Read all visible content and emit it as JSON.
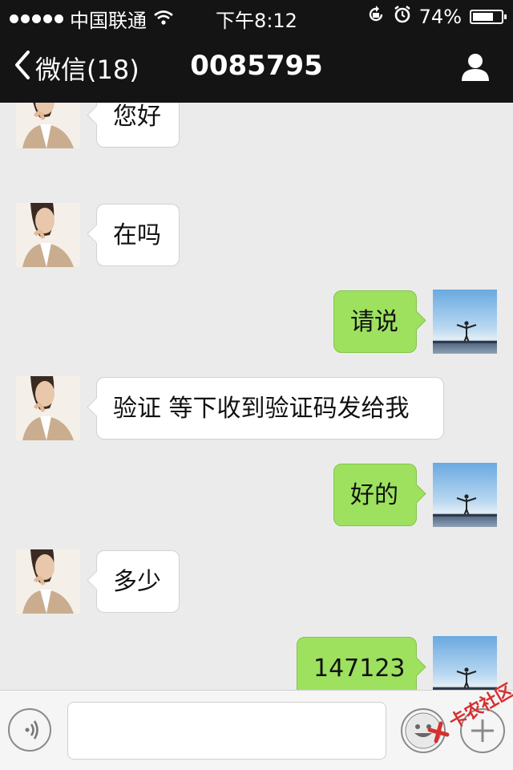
{
  "status_bar": {
    "carrier": "中国联通",
    "time": "下午8:12",
    "battery_percent": "74%",
    "battery_level": 0.74,
    "icons": [
      "signal-dots-icon",
      "wifi-icon",
      "orientation-lock-icon",
      "alarm-icon",
      "battery-icon"
    ]
  },
  "nav": {
    "back_label": "微信(18)",
    "title": "0085795",
    "back_icon": "chevron-left-icon",
    "profile_icon": "person-icon"
  },
  "messages": [
    {
      "direction": "in",
      "text": "您好",
      "avatar": "contact-avatar"
    },
    {
      "direction": "in",
      "text": "在吗",
      "avatar": "contact-avatar"
    },
    {
      "direction": "out",
      "text": "请说",
      "avatar": "my-avatar"
    },
    {
      "direction": "in",
      "text": "验证 等下收到验证码发给我",
      "avatar": "contact-avatar"
    },
    {
      "direction": "out",
      "text": "好的",
      "avatar": "my-avatar"
    },
    {
      "direction": "in",
      "text": "多少",
      "avatar": "contact-avatar"
    },
    {
      "direction": "out",
      "text": "147123",
      "avatar": "my-avatar"
    }
  ],
  "input_bar": {
    "value": "",
    "placeholder": "",
    "icons": [
      "voice-icon",
      "emoji-icon",
      "plus-icon"
    ]
  },
  "watermark": {
    "text": "卡农社区"
  },
  "colors": {
    "bar_bg": "#141414",
    "chat_bg": "#ebebeb",
    "incoming_bubble": "#ffffff",
    "outgoing_bubble": "#9de15f"
  }
}
